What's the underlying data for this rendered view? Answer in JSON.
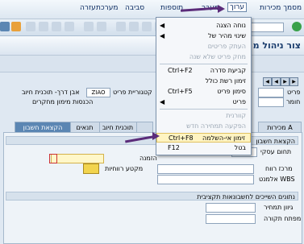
{
  "menubar": {
    "items": [
      "מסמך מכירות",
      "ערוך",
      "מעבר",
      "תוספות",
      "סביבה",
      "מערכת",
      "עזרה"
    ]
  },
  "title": {
    "text": "צור ניהול מ"
  },
  "header": {
    "label_item": "פריט",
    "label_material": "חומר",
    "label_category": "קטגוריית פריט",
    "category_value": "ZIAO",
    "label_billing_plan": "אבן דרך- תוכנית חיוב",
    "label_revenue": "הכנסות מימון מחקרים"
  },
  "tabs": [
    "מכירות A",
    "",
    "תוכנית חיוב",
    "תנאים",
    "הקצאת חשבון"
  ],
  "pane": {
    "section_account": "הקצאת חשבון",
    "business_area": "תחום עסקי",
    "order": "הזמנה",
    "profit_center": "מרכז רווח",
    "profitability_segment": "מקטע רווחיות",
    "wbs_element": "אלמנט WBS",
    "section_budget": "נתונים השייכים לחשבונאות תקציבית",
    "budget_fund": "גיוון תמחיר",
    "funds_center": "מפתח תקורה"
  },
  "dropdown": {
    "items": [
      {
        "label": "נוחה הצגה",
        "shortcut": "",
        "arrow": "◀",
        "disabled": false
      },
      {
        "label": "שינוי מהיר של",
        "shortcut": "",
        "arrow": "◀",
        "disabled": false
      },
      {
        "label": "העתק פריטים",
        "shortcut": "",
        "arrow": "",
        "disabled": true
      },
      {
        "label": "מחק פריט שלא שנה",
        "shortcut": "",
        "arrow": "",
        "disabled": true
      },
      {
        "label": "קביעת סדרה",
        "shortcut": "Ctrl+F2",
        "arrow": "",
        "disabled": false
      },
      {
        "label": "זימון רשת כולל",
        "shortcut": "",
        "arrow": "",
        "disabled": false
      },
      {
        "label": "סימון פריט",
        "shortcut": "Ctrl+F5",
        "arrow": "",
        "disabled": false
      },
      {
        "label": "פריט",
        "shortcut": "",
        "arrow": "◀",
        "disabled": false
      },
      {
        "label": "קוורנית",
        "shortcut": "",
        "arrow": "",
        "disabled": true
      },
      {
        "label": "הפקעה תמחירה חדש",
        "shortcut": "",
        "arrow": "",
        "disabled": true
      },
      {
        "label": "זימון אי-השלמה",
        "shortcut": "Ctrl+F8",
        "arrow": "",
        "disabled": false
      },
      {
        "label": "בטל",
        "shortcut": "F12",
        "arrow": "",
        "disabled": false
      }
    ]
  },
  "colors": {
    "accent": "#5b2c7a",
    "highlight": "#fff4c2",
    "tab_active": "#5b86b3"
  }
}
